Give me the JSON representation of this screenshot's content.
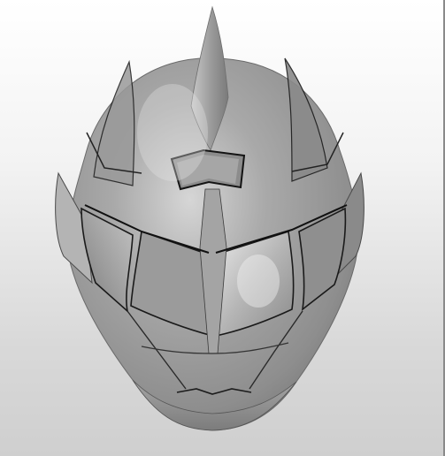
{
  "viewport": {
    "background_top": "#ffffff",
    "background_bottom": "#cfcfcf"
  },
  "model": {
    "name": "helmet-3d-model",
    "base_color": "#9e9e9e",
    "shadow_color": "#5e5e5e",
    "highlight_color": "#e0e0e0",
    "edge_color": "#1a1a1a"
  }
}
